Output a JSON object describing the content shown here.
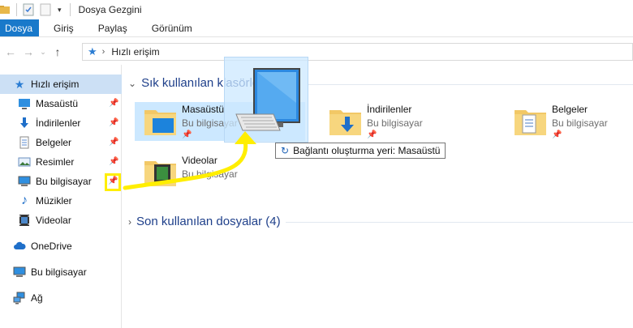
{
  "window": {
    "title": "Dosya Gezgini"
  },
  "ribbon": {
    "tabs": [
      {
        "label": "Dosya",
        "active": true
      },
      {
        "label": "Giriş"
      },
      {
        "label": "Paylaş"
      },
      {
        "label": "Görünüm"
      }
    ]
  },
  "address": {
    "crumb": "Hızlı erişim"
  },
  "sidebar": {
    "items": [
      {
        "label": "Hızlı erişim",
        "icon": "star-icon",
        "selected": true
      },
      {
        "label": "Masaüstü",
        "icon": "desktop-icon",
        "pinned": true
      },
      {
        "label": "İndirilenler",
        "icon": "download-icon",
        "pinned": true
      },
      {
        "label": "Belgeler",
        "icon": "document-icon",
        "pinned": true
      },
      {
        "label": "Resimler",
        "icon": "pictures-icon",
        "pinned": true
      },
      {
        "label": "Bu bilgisayar",
        "icon": "computer-icon",
        "pinned": true
      },
      {
        "label": "Müzikler",
        "icon": "music-icon"
      },
      {
        "label": "Videolar",
        "icon": "video-icon"
      },
      {
        "label": "OneDrive",
        "icon": "cloud-icon"
      },
      {
        "label": "Bu bilgisayar",
        "icon": "computer-icon"
      },
      {
        "label": "Ağ",
        "icon": "network-icon"
      }
    ]
  },
  "main": {
    "frequent_header": "Sık kullanılan klasörler (7)",
    "recent_header": "Son kullanılan dosyalar (4)",
    "folders": [
      {
        "name": "Masaüstü",
        "location": "Bu bilgisayar",
        "pinned": true,
        "selected": true
      },
      {
        "name": "İndirilenler",
        "location": "Bu bilgisayar",
        "pinned": true
      },
      {
        "name": "Belgeler",
        "location": "Bu bilgisayar",
        "pinned": true
      },
      {
        "name": "Videolar",
        "location": "Bu bilgisayar"
      }
    ],
    "tooltip": "Bağlantı oluşturma yeri: Masaüstü"
  },
  "colors": {
    "accent": "#1979ca",
    "selection": "#cce8ff",
    "annotation": "#ffee00",
    "header_text": "#1e3f8a"
  }
}
